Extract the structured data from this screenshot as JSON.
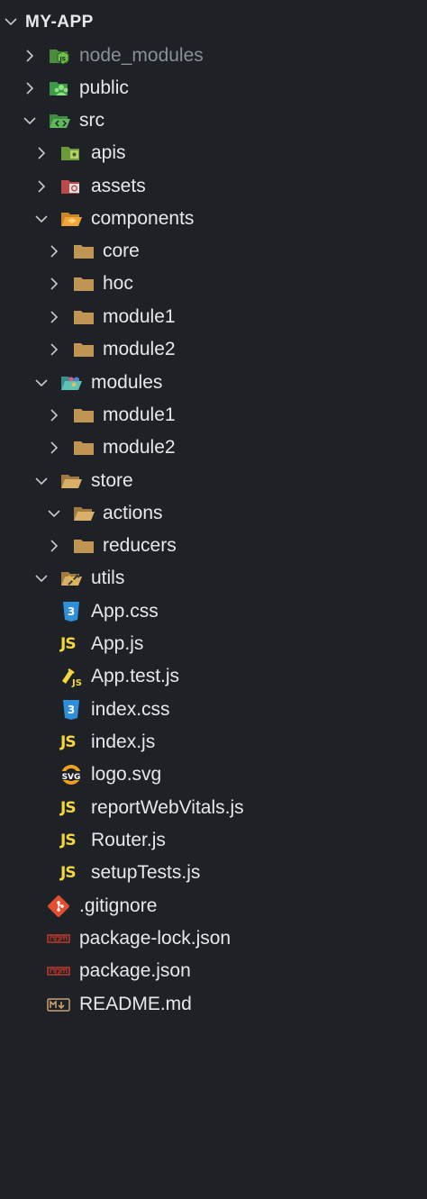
{
  "explorer": {
    "title": "MY-APP",
    "items": [
      {
        "label": "node_modules"
      },
      {
        "label": "public"
      },
      {
        "label": "src"
      },
      {
        "label": "apis"
      },
      {
        "label": "assets"
      },
      {
        "label": "components"
      },
      {
        "label": "core"
      },
      {
        "label": "hoc"
      },
      {
        "label": "module1"
      },
      {
        "label": "module2"
      },
      {
        "label": "modules"
      },
      {
        "label": "module1"
      },
      {
        "label": "module2"
      },
      {
        "label": "store"
      },
      {
        "label": "actions"
      },
      {
        "label": "reducers"
      },
      {
        "label": "utils"
      },
      {
        "label": "App.css"
      },
      {
        "label": "App.js"
      },
      {
        "label": "App.test.js"
      },
      {
        "label": "index.css"
      },
      {
        "label": "index.js"
      },
      {
        "label": "logo.svg"
      },
      {
        "label": "reportWebVitals.js"
      },
      {
        "label": "Router.js"
      },
      {
        "label": "setupTests.js"
      },
      {
        "label": ".gitignore"
      },
      {
        "label": "package-lock.json"
      },
      {
        "label": "package.json"
      },
      {
        "label": "README.md"
      }
    ]
  },
  "icons": {
    "chevron_right": "chevron-right-icon",
    "chevron_down": "chevron-down-icon",
    "folder": "folder-icon",
    "folder_open": "folder-open-icon",
    "node": "nodejs-folder-icon",
    "public": "public-folder-icon",
    "src": "src-folder-icon",
    "css": "css-file-icon",
    "js": "js-file-icon",
    "test": "test-file-icon",
    "svg": "svg-file-icon",
    "git": "git-icon",
    "npm": "npm-icon",
    "markdown": "markdown-icon"
  },
  "colors": {
    "background": "#1e2227",
    "text": "#e8e8e8",
    "dim_text": "#8a8f98",
    "folder": "#c09553",
    "js": "#f5d63d",
    "css": "#2f8fd8",
    "git": "#e24e2f",
    "npm": "#c0392b"
  }
}
